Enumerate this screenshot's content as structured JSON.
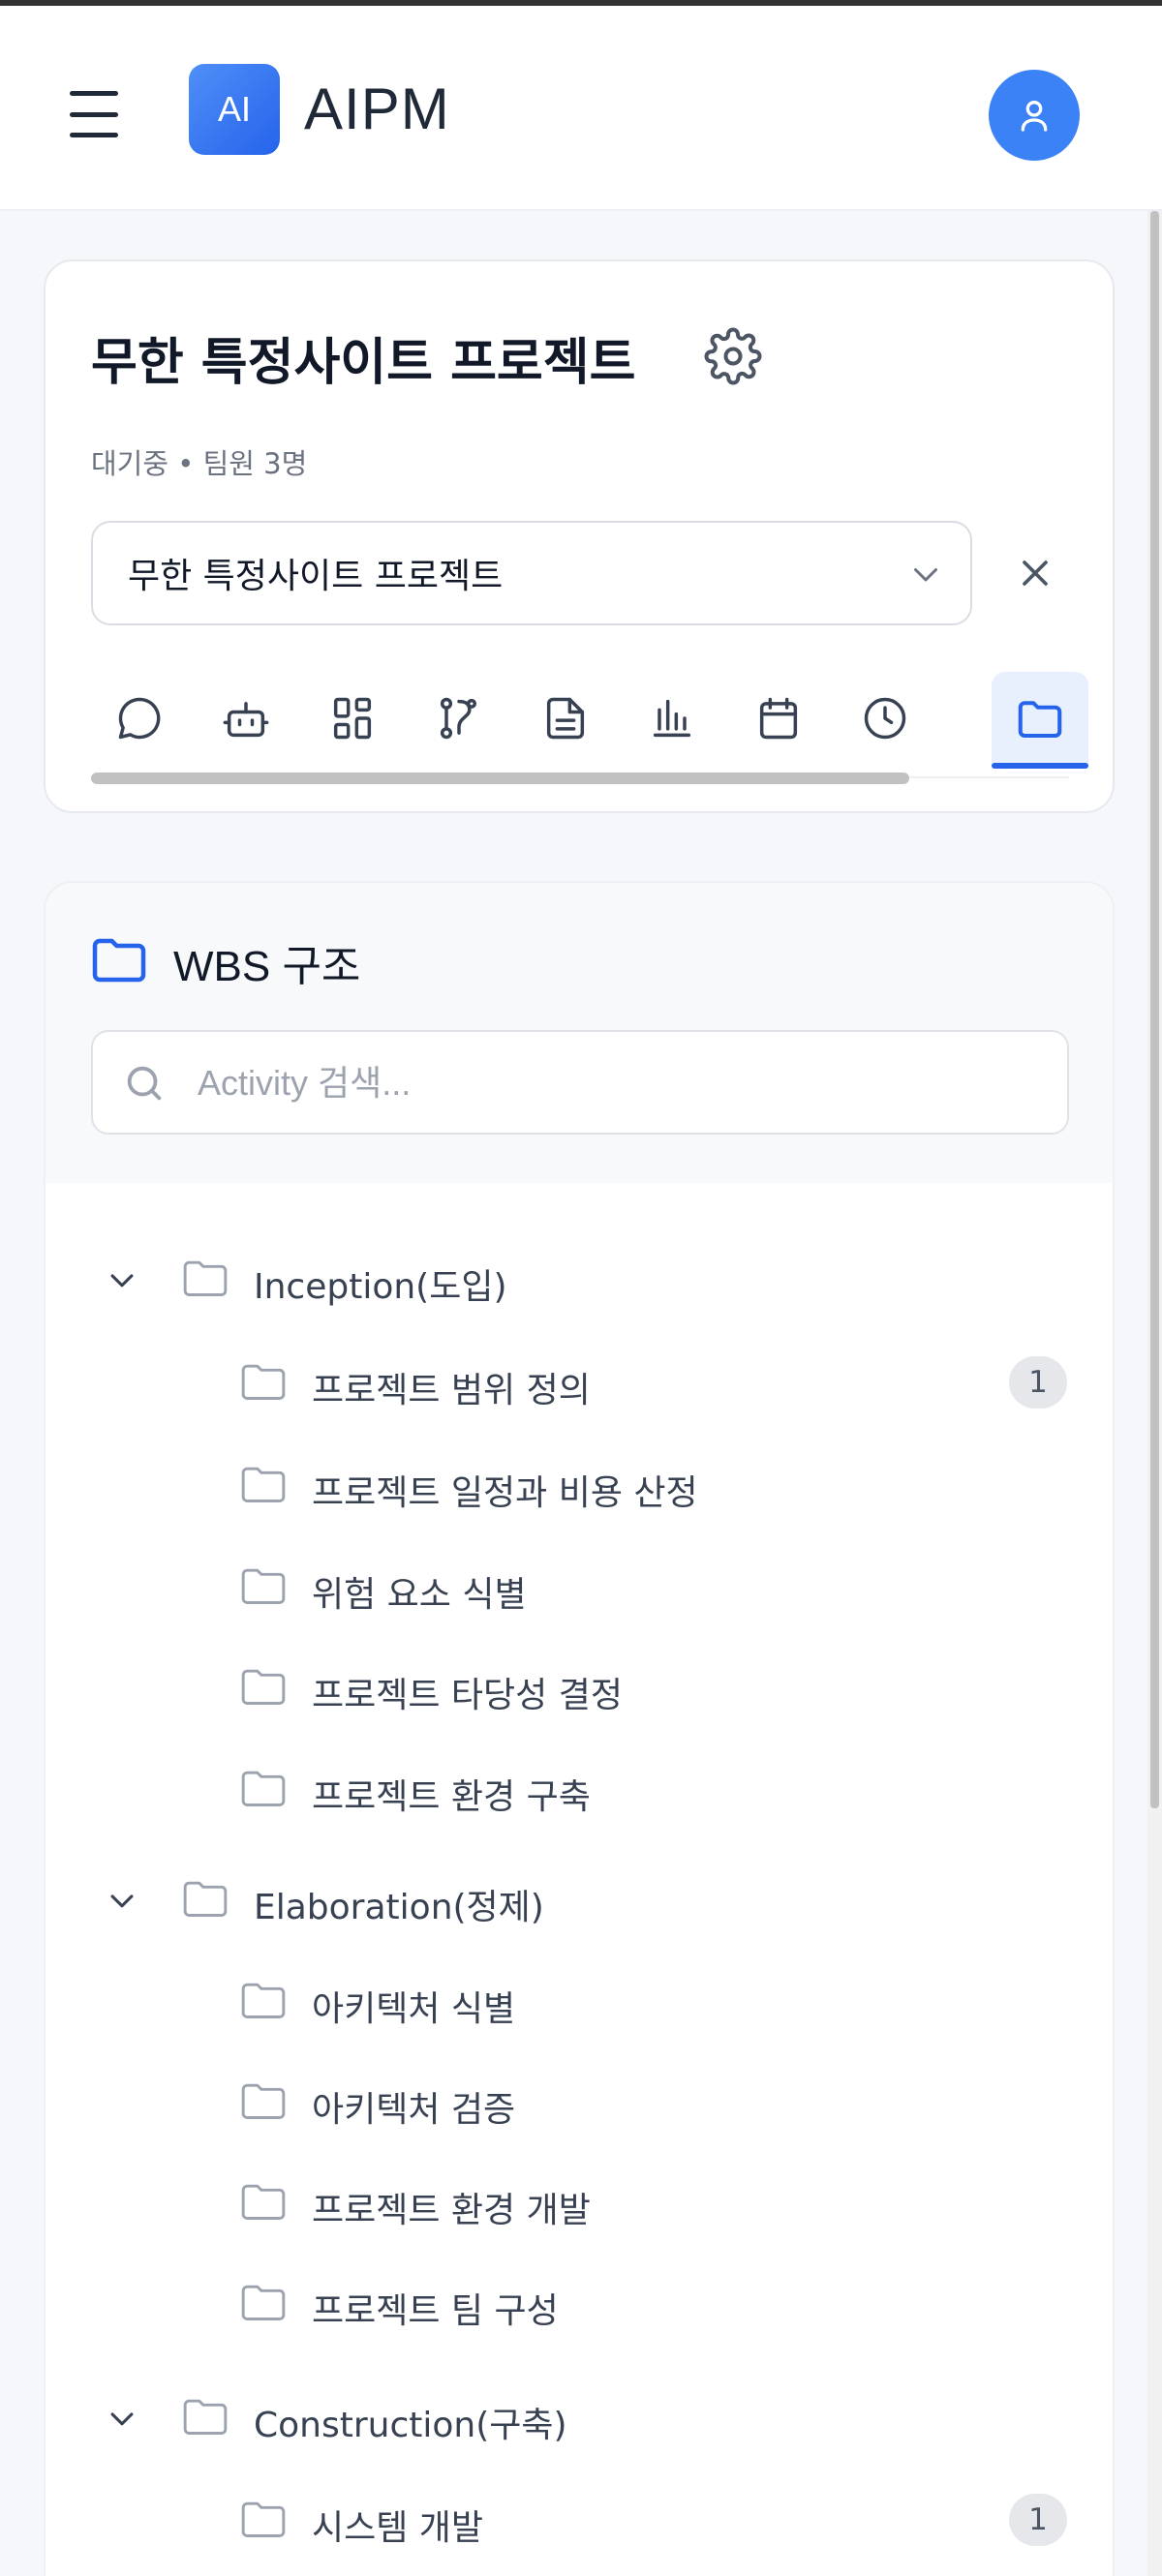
{
  "header": {
    "logo_text": "AI",
    "app_title": "AIPM"
  },
  "project": {
    "title": "무한 특정사이트 프로젝트",
    "meta": "대기중 • 팀원 3명",
    "selected": "무한 특정사이트 프로젝트",
    "tabs": [
      {
        "icon": "chat-icon",
        "active": false
      },
      {
        "icon": "bot-icon",
        "active": false
      },
      {
        "icon": "dashboard-icon",
        "active": false
      },
      {
        "icon": "workflow-icon",
        "active": false
      },
      {
        "icon": "document-icon",
        "active": false
      },
      {
        "icon": "bar-chart-icon",
        "active": false
      },
      {
        "icon": "calendar-icon",
        "active": false
      },
      {
        "icon": "clock-icon",
        "active": false
      },
      {
        "icon": "folder-icon",
        "active": true
      }
    ]
  },
  "wbs": {
    "title": "WBS 구조",
    "search_placeholder": "Activity 검색...",
    "tree": [
      {
        "label": "Inception(도입)",
        "level": 0,
        "expanded": true
      },
      {
        "label": "프로젝트 범위 정의",
        "level": 1,
        "badge": "1"
      },
      {
        "label": "프로젝트 일정과 비용 산정",
        "level": 1
      },
      {
        "label": "위험 요소 식별",
        "level": 1
      },
      {
        "label": "프로젝트 타당성 결정",
        "level": 1
      },
      {
        "label": "프로젝트 환경 구축",
        "level": 1
      },
      {
        "label": "Elaboration(정제)",
        "level": 0,
        "expanded": true
      },
      {
        "label": "아키텍처 식별",
        "level": 1
      },
      {
        "label": "아키텍처 검증",
        "level": 1
      },
      {
        "label": "프로젝트 환경 개발",
        "level": 1
      },
      {
        "label": "프로젝트 팀 구성",
        "level": 1
      },
      {
        "label": "Construction(구축)",
        "level": 0,
        "expanded": true
      },
      {
        "label": "시스템 개발",
        "level": 1,
        "badge": "1"
      }
    ]
  },
  "colors": {
    "accent": "#2563eb",
    "avatar": "#3b82f6",
    "badge_bg": "#e5e7eb"
  }
}
